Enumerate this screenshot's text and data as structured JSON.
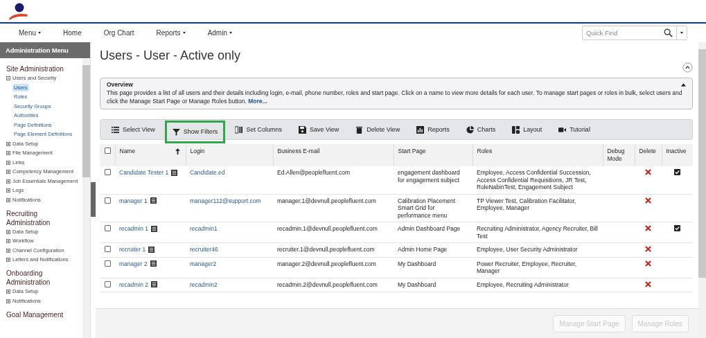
{
  "nav": {
    "items": [
      {
        "label": "Menu",
        "dropdown": true
      },
      {
        "label": "Home",
        "dropdown": false
      },
      {
        "label": "Org Chart",
        "dropdown": false
      },
      {
        "label": "Reports",
        "dropdown": true
      },
      {
        "label": "Admin",
        "dropdown": true
      }
    ],
    "search": {
      "placeholder": "Quick Find"
    }
  },
  "sidebar": {
    "title": "Administration Menu",
    "sections": [
      {
        "title": "Site Administration",
        "items": [
          {
            "label": "Users and Security",
            "expanded": true,
            "children": [
              {
                "label": "Users",
                "selected": true
              },
              {
                "label": "Roles",
                "selected": false
              },
              {
                "label": "Security Groups",
                "selected": false
              },
              {
                "label": "Authorities",
                "selected": false
              },
              {
                "label": "Page Definitions",
                "selected": false
              },
              {
                "label": "Page Element Definitions",
                "selected": false
              }
            ]
          },
          {
            "label": "Data Setup",
            "expanded": false
          },
          {
            "label": "File Management",
            "expanded": false
          },
          {
            "label": "Links",
            "expanded": false
          },
          {
            "label": "Competency Management",
            "expanded": false
          },
          {
            "label": "Job Essentials Management",
            "expanded": false
          },
          {
            "label": "Logs",
            "expanded": false
          },
          {
            "label": "Notifications",
            "expanded": false
          }
        ]
      },
      {
        "title": "Recruiting Administration",
        "items": [
          {
            "label": "Data Setup",
            "expanded": false
          },
          {
            "label": "Workflow",
            "expanded": false
          },
          {
            "label": "Channel Configuration",
            "expanded": false
          },
          {
            "label": "Letters and Notifications",
            "expanded": false
          }
        ]
      },
      {
        "title": "Onboarding Administration",
        "items": [
          {
            "label": "Data Setup",
            "expanded": false
          },
          {
            "label": "Notifications",
            "expanded": false
          }
        ]
      },
      {
        "title": "Goal Management"
      }
    ]
  },
  "page": {
    "title": "Users - User - Active only"
  },
  "overview": {
    "title": "Overview",
    "text": "This page provides a list of all users and their details including login, e-mail, phone number, roles and start page. Click on a name to view more details for each user. To manage start pages or roles in bulk, select users and click the Manage Start Page or Manage Roles button.",
    "link": "More..."
  },
  "toolbar": [
    {
      "label": "Select View",
      "highlighted": false
    },
    {
      "label": "Show Filters",
      "highlighted": true
    },
    {
      "label": "Set Columns",
      "highlighted": false
    },
    {
      "label": "Save View",
      "highlighted": false
    },
    {
      "label": "Delete View",
      "highlighted": false
    },
    {
      "label": "Reports",
      "highlighted": false
    },
    {
      "label": "Charts",
      "highlighted": false
    },
    {
      "label": "Layout",
      "highlighted": false
    },
    {
      "label": "Tutorial",
      "highlighted": false
    }
  ],
  "table": {
    "select_all_checked": false,
    "columns": [
      "Name",
      "Login",
      "Business E-mail",
      "Start Page",
      "Roles",
      "Debug Mode",
      "Delete",
      "Inactive"
    ],
    "rows": [
      {
        "checked": false,
        "name": "Candidate Tester 1",
        "login": "Candidate.ed",
        "email": "Ed.Allen@peoplefluent.com",
        "start_page": "engagement dashboard for engagement subject",
        "roles": "Employee, Access Confidential Succession, Access Confidential Requisitions, JR Test, RoleNabinTest, Engagement Subject",
        "inactive": true
      },
      {
        "checked": false,
        "name": "manager 1",
        "login": "manager112@support.com",
        "email": "manager.1@devnull.peoplefluent.com",
        "start_page": "Calibration Placement Smart Grid for performance menu",
        "roles": "TP Viewer Test, Calibration Facilitator, Employee, Manager",
        "inactive": false
      },
      {
        "checked": false,
        "name": "recadmin 1",
        "login": "recadmin1",
        "email": "recadmin.1@devnull.peoplefluent.com",
        "start_page": "Admin Dashboard Page",
        "roles": "Recruiting Administrator, Agency Recruiter, Bill Test",
        "inactive": true
      },
      {
        "checked": false,
        "name": "recruiter 1",
        "login": "recruiter46",
        "email": "recruiter.1@devnull.peoplefluent.com",
        "start_page": "Admin Home Page",
        "roles": "Employee, User Security Administrator",
        "inactive": false
      },
      {
        "checked": false,
        "name": "manager 2",
        "login": "manager2",
        "email": "manager.2@devnull.peoplefluent.com",
        "start_page": "My Dashboard",
        "roles": "Power Recruiter, Employee, Recruiter, Manager",
        "inactive": false
      },
      {
        "checked": false,
        "name": "recadmin 2",
        "login": "recadmin2",
        "email": "recadmin.2@devnull.peoplefluent.com",
        "start_page": "My Dashboard",
        "roles": "Employee, Recruiting Administrator",
        "inactive": false
      }
    ]
  },
  "footer": {
    "buttons": [
      {
        "label": "Manage Start Page",
        "disabled": true
      },
      {
        "label": "Manage Roles",
        "disabled": true
      }
    ]
  }
}
